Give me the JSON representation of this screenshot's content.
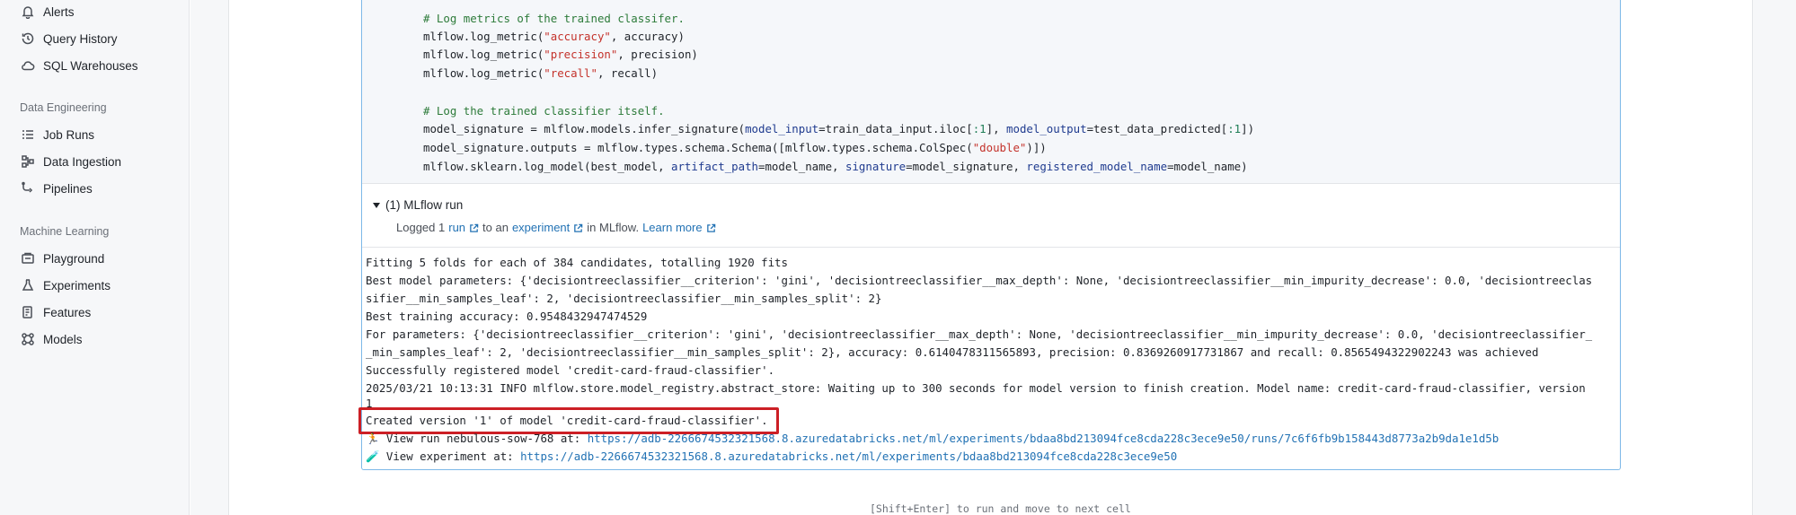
{
  "sidebar": {
    "items_top": [
      {
        "label": "Alerts",
        "icon": "bell-icon"
      },
      {
        "label": "Query History",
        "icon": "history-icon"
      },
      {
        "label": "SQL Warehouses",
        "icon": "cloud-icon"
      }
    ],
    "data_engineering": {
      "label": "Data Engineering",
      "items": [
        {
          "label": "Job Runs",
          "icon": "list-icon"
        },
        {
          "label": "Data Ingestion",
          "icon": "ingestion-icon"
        },
        {
          "label": "Pipelines",
          "icon": "pipeline-icon"
        }
      ]
    },
    "machine_learning": {
      "label": "Machine Learning",
      "items": [
        {
          "label": "Playground",
          "icon": "playground-icon"
        },
        {
          "label": "Experiments",
          "icon": "flask-icon"
        },
        {
          "label": "Features",
          "icon": "features-icon"
        },
        {
          "label": "Models",
          "icon": "models-icon"
        }
      ]
    }
  },
  "code": {
    "comment1": "# Log metrics of the trained classifer.",
    "line_accuracy_pre": "mlflow.log_metric(",
    "line_accuracy_str": "\"accuracy\"",
    "line_accuracy_post": ", accuracy)",
    "line_precision_str": "\"precision\"",
    "line_precision_post": ", precision)",
    "line_recall_str": "\"recall\"",
    "line_recall_post": ", recall)",
    "comment2": "# Log the trained classifier itself.",
    "sig_a": "model_signature = mlflow.models.infer_signature(",
    "sig_b": "model_input",
    "sig_c": "=train_data_input.iloc[",
    "sig_d": ":1",
    "sig_e": "], ",
    "sig_f": "model_output",
    "sig_g": "=test_data_predicted[",
    "sig_h": ":1",
    "sig_i": "])",
    "out_a": "model_signature.outputs = mlflow.types.schema.Schema([mlflow.types.schema.ColSpec(",
    "out_b": "\"double\"",
    "out_c": ")])",
    "log_a": "mlflow.sklearn.log_model(best_model, ",
    "log_b": "artifact_path",
    "log_c": "=model_name, ",
    "log_d": "signature",
    "log_e": "=model_signature, ",
    "log_f": "registered_model_name",
    "log_g": "=model_name)"
  },
  "mlflow_run": {
    "title": "(1) MLflow run",
    "logged_prefix": "Logged 1",
    "run_link": "run",
    "middle": "to an",
    "experiment_link": "experiment",
    "in_mlflow": "in MLflow.",
    "learn_more": "Learn more"
  },
  "output": {
    "line1": "Fitting 5 folds for each of 384 candidates, totalling 1920 fits",
    "line2": "Best model parameters: {'decisiontreeclassifier__criterion': 'gini', 'decisiontreeclassifier__max_depth': None, 'decisiontreeclassifier__min_impurity_decrease': 0.0, 'decisiontreeclas",
    "line3": "sifier__min_samples_leaf': 2, 'decisiontreeclassifier__min_samples_split': 2}",
    "line4": "Best training accuracy: 0.9548432947474529",
    "line5": "For parameters: {'decisiontreeclassifier__criterion': 'gini', 'decisiontreeclassifier__max_depth': None, 'decisiontreeclassifier__min_impurity_decrease': 0.0, 'decisiontreeclassifier_",
    "line6": "_min_samples_leaf': 2, 'decisiontreeclassifier__min_samples_split': 2}, accuracy: 0.6140478311565893, precision: 0.8369260917731867 and recall: 0.8565494322902243 was achieved",
    "line7": "Successfully registered model 'credit-card-fraud-classifier'.",
    "line8": "2025/03/21 10:13:31 INFO mlflow.store.model_registry.abstract_store: Waiting up to 300 seconds for model version to finish creation. Model name: credit-card-fraud-classifier, version",
    "line9": "1",
    "line10": "Created version '1' of model 'credit-card-fraud-classifier'.",
    "run_prefix": "🏃 View run nebulous-sow-768 at: ",
    "run_url": "https://adb-2266674532321568.8.azuredatabricks.net/ml/experiments/bdaa8bd213094fce8cda228c3ece9e50/runs/7c6f6fb9b158443d8773a2b9da1e1d5b",
    "exp_prefix": "🧪 View experiment at: ",
    "exp_url": "https://adb-2266674532321568.8.azuredatabricks.net/ml/experiments/bdaa8bd213094fce8cda228c3ece9e50"
  },
  "footer_hint": "[Shift+Enter] to run and move to next cell"
}
